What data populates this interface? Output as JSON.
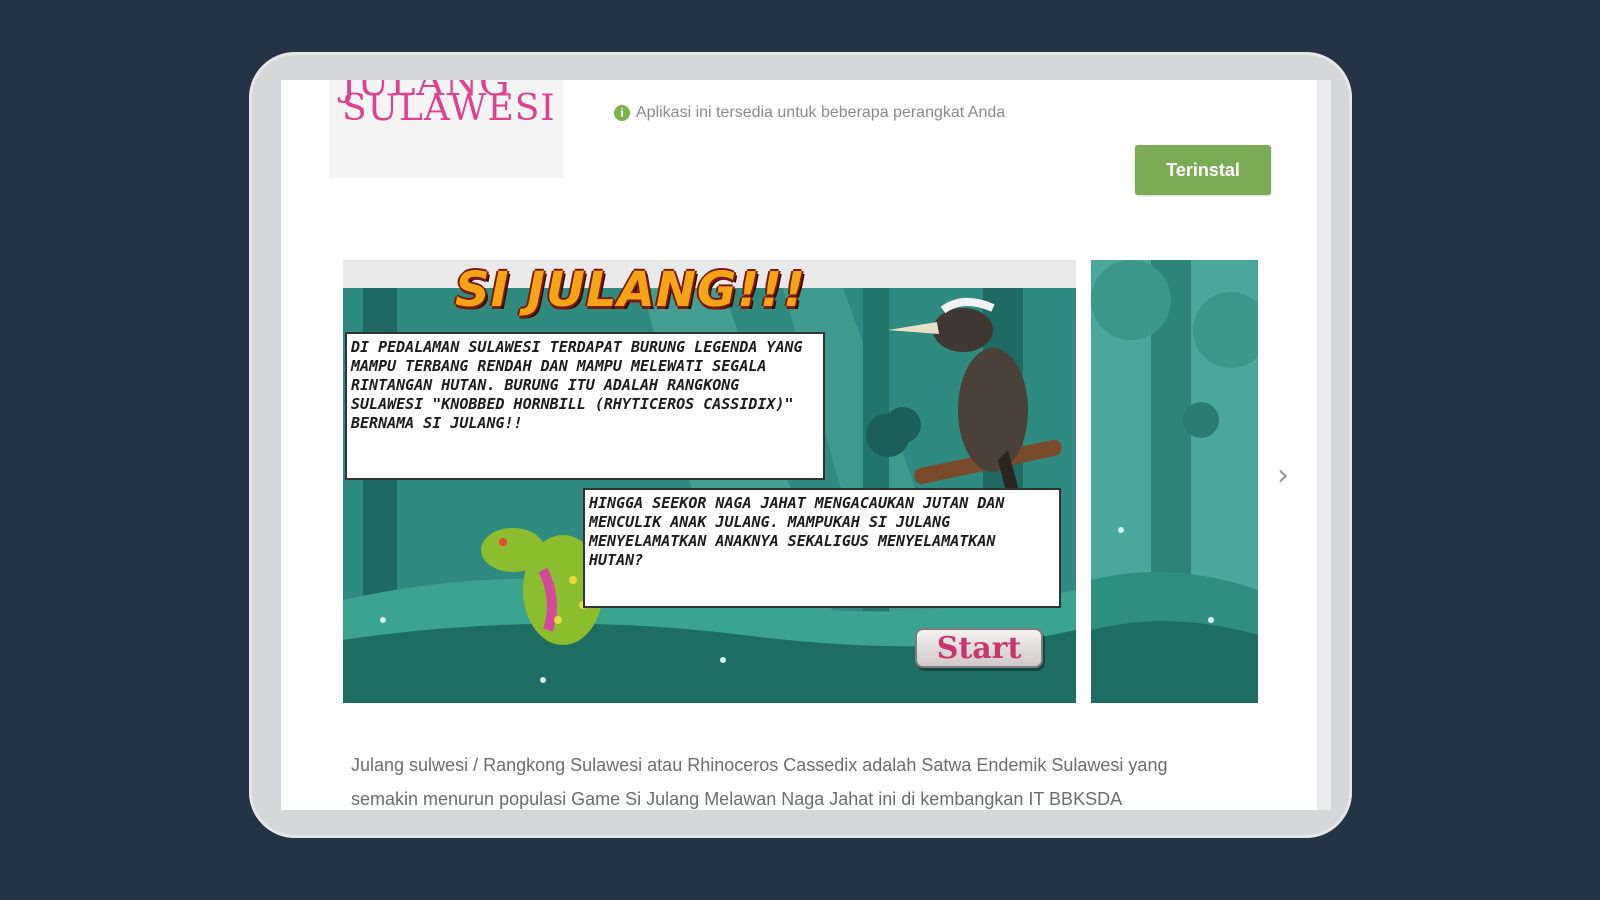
{
  "app": {
    "icon_text": "SULAWESI",
    "icon_text_top": "JULANG",
    "availability_text": "Aplikasi ini tersedia untuk beberapa perangkat Anda",
    "info_icon": "info-circle-icon",
    "install_label": "Terinstal"
  },
  "screenshot": {
    "game_title": "SI JULANG!!!",
    "story_1": "Di pedalaman Sulawesi terdapat burung legenda yang mampu terbang rendah dan mampu melewati segala rintangan hutan. Burung itu adalah Rangkong Sulawesi \"Knobbed Hornbill (Rhyticeros Cassidix)\" bernama Si Julang!!",
    "story_2": "Hingga seekor naga jahat mengacaukan jutan dan menculik anak Julang. Mampukah Si Julang menyelamatkan anaknya sekaligus menyelamatkan hutan?",
    "start_label": "Start",
    "next_icon": "chevron-right-icon",
    "next_glyph": "›"
  },
  "description": {
    "line1": "Julang sulwesi / Rangkong Sulawesi atau Rhinoceros Cassedix adalah Satwa Endemik Sulawesi yang",
    "line2": "semakin menurun populasi Game Si Julang Melawan Naga Jahat ini di kembangkan IT BBKSDA"
  },
  "colors": {
    "page_bg": "#253444",
    "device_frame": "#d5d7d8",
    "install_button": "#7bab55",
    "icon_pink": "#e0418e",
    "forest_teal": "#2c7d78"
  }
}
